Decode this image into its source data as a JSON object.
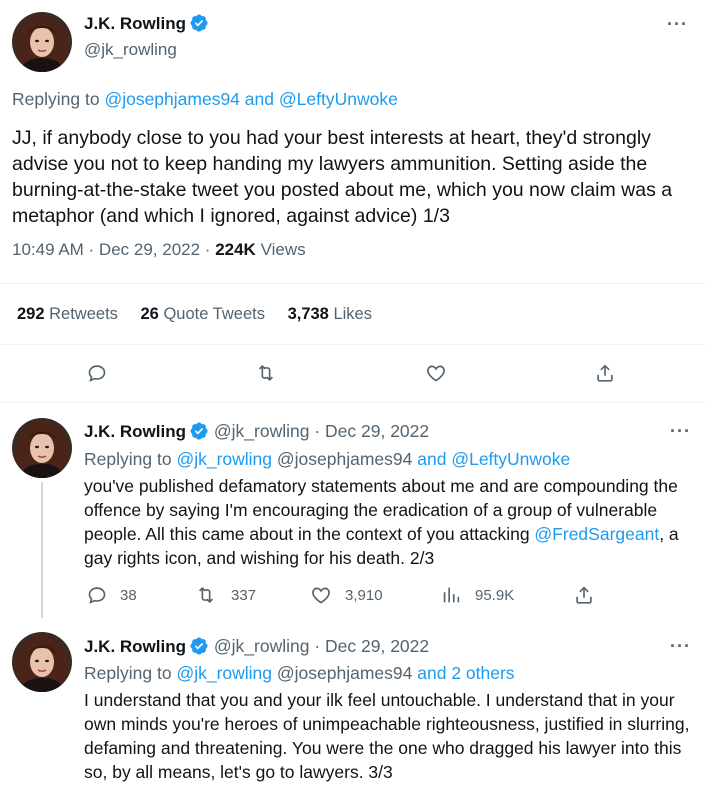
{
  "main_tweet": {
    "author_name": "J.K. Rowling",
    "handle": "@jk_rowling",
    "replying_label": "Replying to",
    "replying_user1": "@josephjames94",
    "replying_and": "and",
    "replying_user2": "@LeftyUnwoke",
    "text": "JJ, if anybody close to you had your best interests at heart, they'd strongly advise you not to keep handing my lawyers ammunition. Setting aside the burning-at-the-stake tweet you posted about me, which you now claim was a metaphor (and which I ignored, against advice) 1/3",
    "time": "10:49 AM · Dec 29, 2022 ·",
    "views_count": "224K",
    "views_label": "Views",
    "retweets_count": "292",
    "retweets_label": "Retweets",
    "quotes_count": "26",
    "quotes_label": "Quote Tweets",
    "likes_count": "3,738",
    "likes_label": "Likes"
  },
  "replies": [
    {
      "author_name": "J.K. Rowling",
      "handle": "@jk_rowling",
      "date": "· Dec 29, 2022",
      "replying_label": "Replying to",
      "replying_user1": "@jk_rowling",
      "replying_user2": "@josephjames94",
      "replying_and": "and",
      "replying_user3": "@LeftyUnwoke",
      "text_before": "you've published defamatory statements about me and are compounding the offence by saying I'm encouraging the eradication of a group of vulnerable people. All this came about in the context of you attacking ",
      "mention": "@FredSargeant",
      "text_after": ", a gay rights icon, and wishing for his death. 2/3",
      "replies_count": "38",
      "retweets_count": "337",
      "likes_count": "3,910",
      "views_count": "95.9K"
    },
    {
      "author_name": "J.K. Rowling",
      "handle": "@jk_rowling",
      "date": "· Dec 29, 2022",
      "replying_label": "Replying to",
      "replying_user1": "@jk_rowling",
      "replying_user2": "@josephjames94",
      "replying_and": "and",
      "replying_others": "2 others",
      "text": "I understand that you and your ilk feel untouchable. I understand that in your own minds you're heroes of unimpeachable righteousness, justified in slurring, defaming and threatening. You were the one who dragged his lawyer into this so, by all means, let's go to lawyers. 3/3"
    }
  ],
  "colors": {
    "accent": "#1d9bf0",
    "secondary_text": "#536471",
    "primary_text": "#0f1419",
    "divider": "#eff3f4"
  },
  "icons": {
    "verified": "verified-badge-icon",
    "more": "more-horizontal-icon",
    "reply": "reply-bubble-icon",
    "retweet": "retweet-arrows-icon",
    "like": "heart-icon",
    "share": "share-upload-icon",
    "views": "views-bar-chart-icon"
  }
}
